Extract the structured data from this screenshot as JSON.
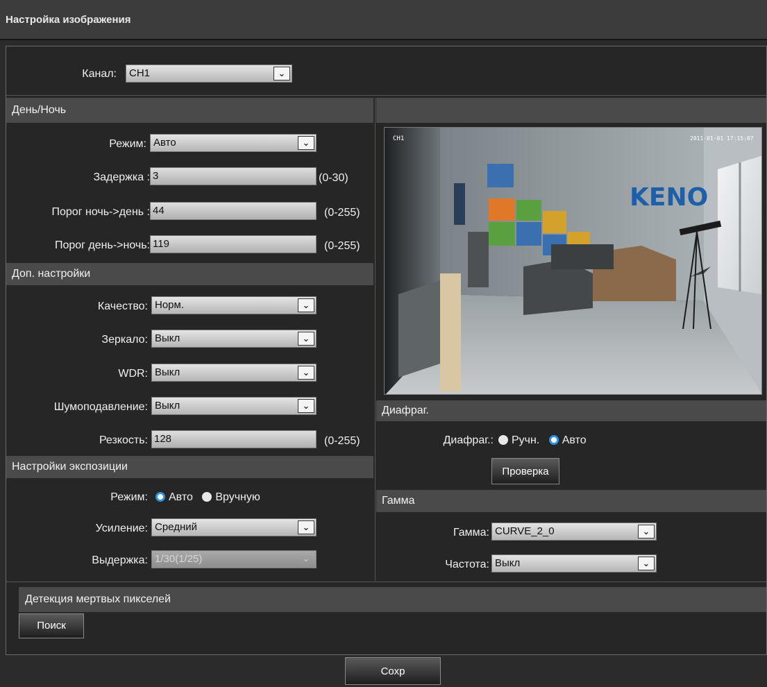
{
  "window": {
    "title": "Настройка изображения"
  },
  "channel": {
    "label": "Канал:",
    "value": "CH1"
  },
  "day_night": {
    "section_title": "День/Ночь",
    "mode": {
      "label": "Режим:",
      "value": "Авто"
    },
    "delay": {
      "label": "Задержка :",
      "value": "3",
      "range": "(0-30)"
    },
    "night_to_day": {
      "label": "Порог ночь->день :",
      "value": "44",
      "range": "(0-255)"
    },
    "day_to_night": {
      "label": "Порог день->ночь:",
      "value": "119",
      "range": "(0-255)"
    }
  },
  "advanced": {
    "section_title": "Доп. настройки",
    "quality": {
      "label": "Качество:",
      "value": "Норм."
    },
    "mirror": {
      "label": "Зеркало:",
      "value": "Выкл"
    },
    "wdr": {
      "label": "WDR:",
      "value": "Выкл"
    },
    "noise": {
      "label": "Шумоподавление:",
      "value": "Выкл"
    },
    "sharpness": {
      "label": "Резкость:",
      "value": "128",
      "range": "(0-255)"
    }
  },
  "exposure": {
    "section_title": "Настройки экспозиции",
    "mode": {
      "label": "Режим:",
      "options": [
        "Авто",
        "Вручную"
      ],
      "selected": "Авто"
    },
    "gain": {
      "label": "Усиление:",
      "value": "Средний"
    },
    "shutter": {
      "label": "Выдержка:",
      "value": "1/30(1/25)",
      "disabled": true
    }
  },
  "preview": {
    "logo_text": "KENO",
    "osd_left": "CH1",
    "osd_right": "2011-01-01 17:15:07"
  },
  "iris": {
    "section_title": "Диафраг.",
    "label": "Диафраг.:",
    "options": [
      "Ручн.",
      "Авто"
    ],
    "selected": "Авто",
    "check_button": "Проверка"
  },
  "gamma": {
    "section_title": "Гамма",
    "gamma": {
      "label": "Гамма:",
      "value": "CURVE_2_0"
    },
    "frequency": {
      "label": "Частота:",
      "value": "Выкл"
    }
  },
  "dead_pixel": {
    "section_title": "Детекция мертвых пикселей",
    "search_button": "Поиск"
  },
  "save_button": "Сохр",
  "colors": {
    "accent": "#2e92e3",
    "section_bg": "#4a4a4a",
    "panel_bg": "#262626"
  },
  "icons": {
    "dropdown": "chevron-down-icon",
    "radio": "radio-icon"
  }
}
